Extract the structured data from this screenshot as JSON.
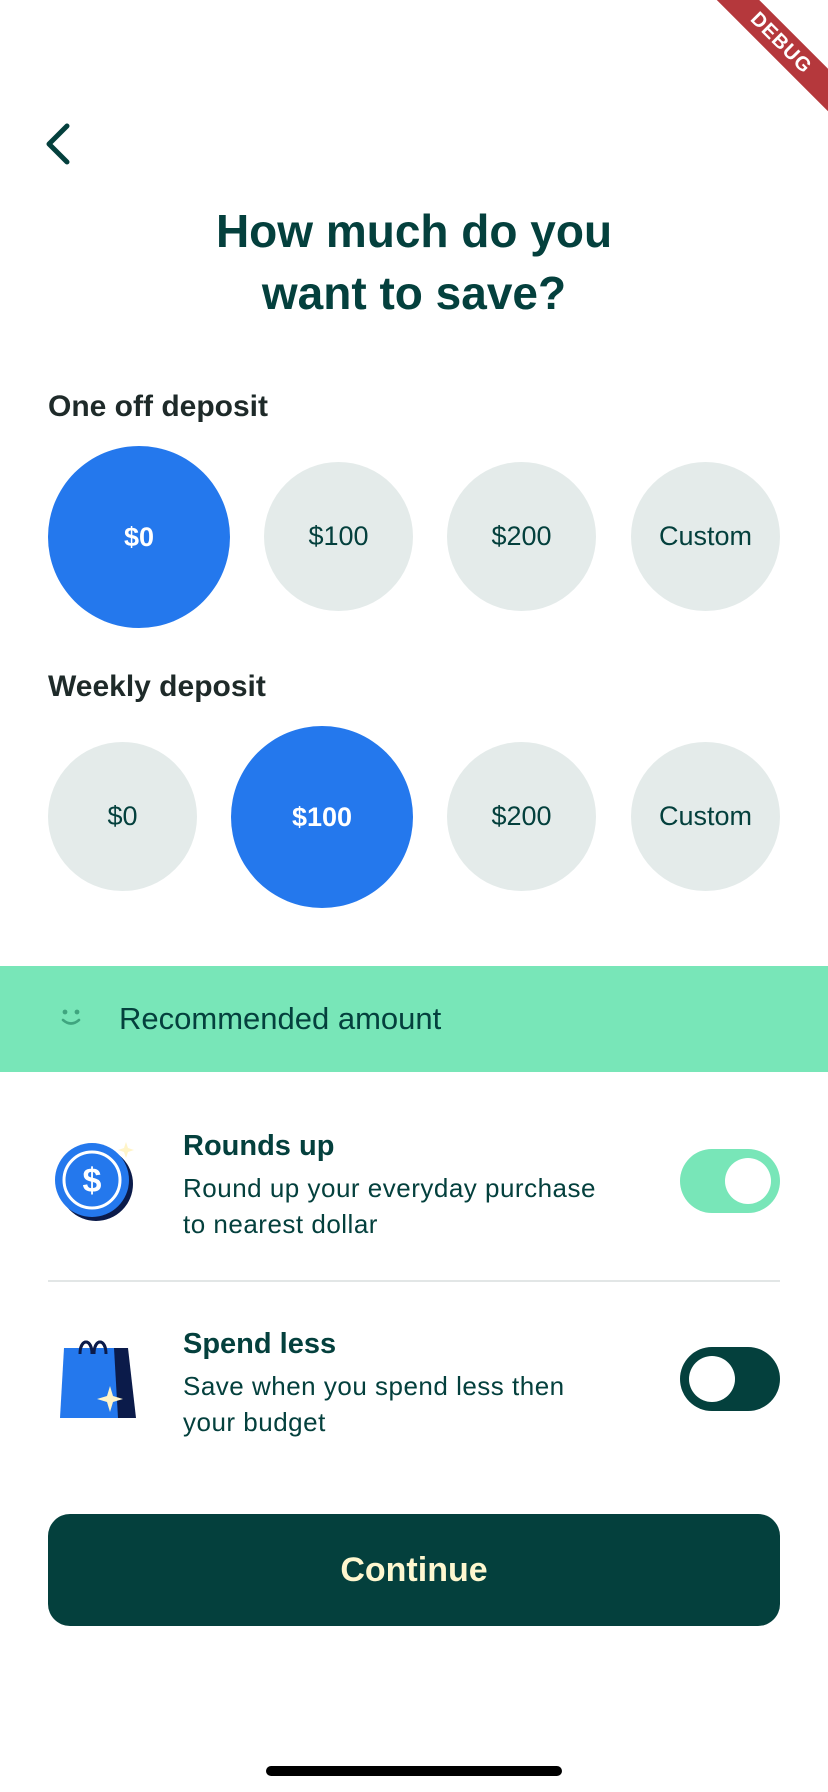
{
  "debug_banner": "DEBUG",
  "nav": {
    "back_icon": "chevron-left-icon"
  },
  "title": {
    "line1": "How much do you",
    "line2": "want to save?"
  },
  "one_off": {
    "label": "One off deposit",
    "options": [
      "$0",
      "$100",
      "$200",
      "Custom"
    ],
    "selected": "$0"
  },
  "weekly": {
    "label": "Weekly deposit",
    "options": [
      "$0",
      "$100",
      "$200",
      "Custom"
    ],
    "selected": "$100"
  },
  "recommended": {
    "icon": "smiley-icon",
    "label": "Recommended amount"
  },
  "features": [
    {
      "icon": "coin-dollar-icon",
      "title": "Rounds up",
      "desc_line1": "Round up your everyday purchase",
      "desc_line2": "to nearest dollar",
      "enabled": true
    },
    {
      "icon": "shopping-bag-icon",
      "title": "Spend less",
      "desc_line1": "Save when you spend less then",
      "desc_line2": "your budget",
      "enabled": false
    }
  ],
  "continue_label": "Continue",
  "colors": {
    "primary": "#04403d",
    "accent_blue": "#2478ed",
    "accent_green": "#78e6b8",
    "chip_bg": "#e4ebea",
    "button_text": "#fef7cf"
  }
}
